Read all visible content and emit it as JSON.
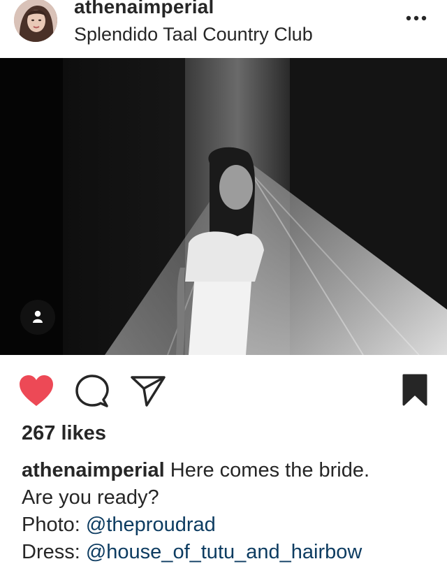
{
  "post": {
    "username": "athenaimperial",
    "location": "Splendido Taal Country Club",
    "likes_text": "267 likes",
    "caption": {
      "username": "athenaimperial",
      "line1_text": "Here comes the bride.",
      "line2_text": "Are you ready?",
      "photo_label": "Photo:",
      "photo_mention": "@theproudrad",
      "dress_label": "Dress:",
      "dress_mention": "@house_of_tutu_and_hairbow"
    }
  },
  "icons": {
    "more": "more-options-icon",
    "tag": "person-tag-icon",
    "like": "heart-icon",
    "comment": "comment-icon",
    "share": "direct-share-icon",
    "save": "bookmark-icon"
  },
  "colors": {
    "like_active": "#ed4956",
    "text": "#262626",
    "mention": "#0d3c61"
  }
}
